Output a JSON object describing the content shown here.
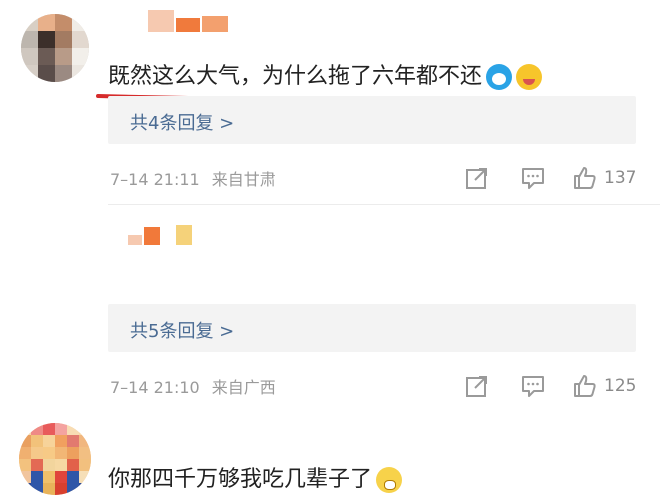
{
  "comments": [
    {
      "text": "既然这么大气，为什么拖了六年都不还",
      "emojis": [
        "doraemon-emoji",
        "smirk-emoji"
      ],
      "reply_label": "共4条回复 >",
      "date": "7–14 21:11",
      "location": "来自甘肃",
      "likes": "137"
    },
    {
      "text": "你那四千万够我吃几辈子了",
      "emojis": [
        "crying-emoji"
      ],
      "reply_label": "共5条回复 >",
      "date": "7–14 21:10",
      "location": "来自广西",
      "likes": "125"
    }
  ],
  "colors": {
    "link": "#4a6b93",
    "meta": "#9a9a9a",
    "highlight_underline": "#d62b2b"
  },
  "icons": [
    "share-icon",
    "comment-icon",
    "like-icon"
  ]
}
